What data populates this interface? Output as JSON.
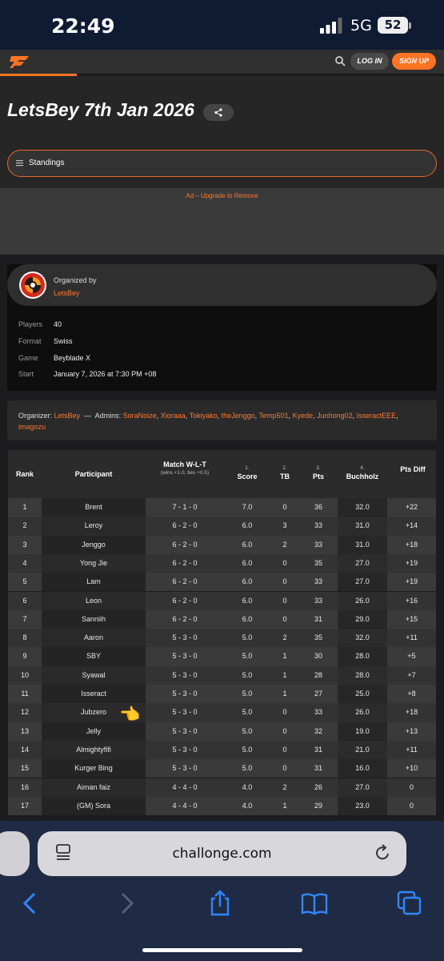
{
  "status_bar": {
    "time": "22:49",
    "network": "5G",
    "battery": "52"
  },
  "nav": {
    "login_label": "LOG IN",
    "signup_label": "SIGN UP"
  },
  "page": {
    "title": "LetsBey 7th Jan 2026",
    "section_label": "Standings"
  },
  "ad": {
    "label": "Ad – Upgrade to Remove"
  },
  "organizer": {
    "organized_by_label": "Organized by",
    "name": "LetsBey",
    "details": [
      {
        "label": "Players",
        "value": "40"
      },
      {
        "label": "Format",
        "value": "Swiss"
      },
      {
        "label": "Game",
        "value": "Beyblade X"
      },
      {
        "label": "Start",
        "value": "January 7, 2026 at 7:30 PM +08"
      }
    ]
  },
  "credits": {
    "organizer_label": "Organizer:",
    "organizer_name": "LetsBey",
    "separator": "—",
    "admins_label": "Admins:",
    "admins": [
      "SoraNoize",
      "Xioraaa",
      "Tokiyako",
      "theJenggo",
      "Temp501",
      "Kyede",
      "Junhong02",
      "IsseractEEE",
      "imagozu"
    ]
  },
  "table": {
    "headers": {
      "rank": "Rank",
      "participant": "Participant",
      "match": "Match W-L-T",
      "match_sub": "(wins +1.0, ties +0.5)",
      "score_num": "1.",
      "score": "Score",
      "tb_num": "2.",
      "tb": "TB",
      "pts_num": "3.",
      "pts": "Pts",
      "buch_num": "4.",
      "buch": "Buchholz",
      "diff": "Pts Diff"
    },
    "rows": [
      {
        "rank": "1",
        "participant": "Brent",
        "match": "7 - 1 - 0",
        "score": "7.0",
        "tb": "0",
        "pts": "36",
        "buchholz": "32.0",
        "diff": "+22"
      },
      {
        "rank": "2",
        "participant": "Leroy",
        "match": "6 - 2 - 0",
        "score": "6.0",
        "tb": "3",
        "pts": "33",
        "buchholz": "31.0",
        "diff": "+14"
      },
      {
        "rank": "3",
        "participant": "Jenggo",
        "match": "6 - 2 - 0",
        "score": "6.0",
        "tb": "2",
        "pts": "33",
        "buchholz": "31.0",
        "diff": "+18"
      },
      {
        "rank": "4",
        "participant": "Yong Jie",
        "match": "6 - 2 - 0",
        "score": "6.0",
        "tb": "0",
        "pts": "35",
        "buchholz": "27.0",
        "diff": "+19"
      },
      {
        "rank": "5",
        "participant": "Lam",
        "match": "6 - 2 - 0",
        "score": "6.0",
        "tb": "0",
        "pts": "33",
        "buchholz": "27.0",
        "diff": "+19"
      },
      {
        "rank": "6",
        "participant": "Leon",
        "match": "6 - 2 - 0",
        "score": "6.0",
        "tb": "0",
        "pts": "33",
        "buchholz": "26.0",
        "diff": "+16"
      },
      {
        "rank": "7",
        "participant": "Sanniih",
        "match": "6 - 2 - 0",
        "score": "6.0",
        "tb": "0",
        "pts": "31",
        "buchholz": "29.0",
        "diff": "+15"
      },
      {
        "rank": "8",
        "participant": "Aaron",
        "match": "5 - 3 - 0",
        "score": "5.0",
        "tb": "2",
        "pts": "35",
        "buchholz": "32.0",
        "diff": "+11"
      },
      {
        "rank": "9",
        "participant": "SBY",
        "match": "5 - 3 - 0",
        "score": "5.0",
        "tb": "1",
        "pts": "30",
        "buchholz": "28.0",
        "diff": "+5"
      },
      {
        "rank": "10",
        "participant": "Syawal",
        "match": "5 - 3 - 0",
        "score": "5.0",
        "tb": "1",
        "pts": "28",
        "buchholz": "28.0",
        "diff": "+7"
      },
      {
        "rank": "11",
        "participant": "Isseract",
        "match": "5 - 3 - 0",
        "score": "5.0",
        "tb": "1",
        "pts": "27",
        "buchholz": "25.0",
        "diff": "+8"
      },
      {
        "rank": "12",
        "participant": "Jubzero",
        "match": "5 - 3 - 0",
        "score": "5.0",
        "tb": "0",
        "pts": "33",
        "buchholz": "26.0",
        "diff": "+18"
      },
      {
        "rank": "13",
        "participant": "Jelly",
        "match": "5 - 3 - 0",
        "score": "5.0",
        "tb": "0",
        "pts": "32",
        "buchholz": "19.0",
        "diff": "+13"
      },
      {
        "rank": "14",
        "participant": "Almightyfifi",
        "match": "5 - 3 - 0",
        "score": "5.0",
        "tb": "0",
        "pts": "31",
        "buchholz": "21.0",
        "diff": "+11"
      },
      {
        "rank": "15",
        "participant": "Kurger Bing",
        "match": "5 - 3 - 0",
        "score": "5.0",
        "tb": "0",
        "pts": "31",
        "buchholz": "16.0",
        "diff": "+10"
      },
      {
        "rank": "16",
        "participant": "Aiman faiz",
        "match": "4 - 4 - 0",
        "score": "4.0",
        "tb": "2",
        "pts": "26",
        "buchholz": "27.0",
        "diff": "0"
      },
      {
        "rank": "17",
        "participant": "(GM) Sora",
        "match": "4 - 4 - 0",
        "score": "4.0",
        "tb": "1",
        "pts": "29",
        "buchholz": "23.0",
        "diff": "0"
      }
    ]
  },
  "pointer_emoji": "👈",
  "browser": {
    "url": "challonge.com"
  }
}
